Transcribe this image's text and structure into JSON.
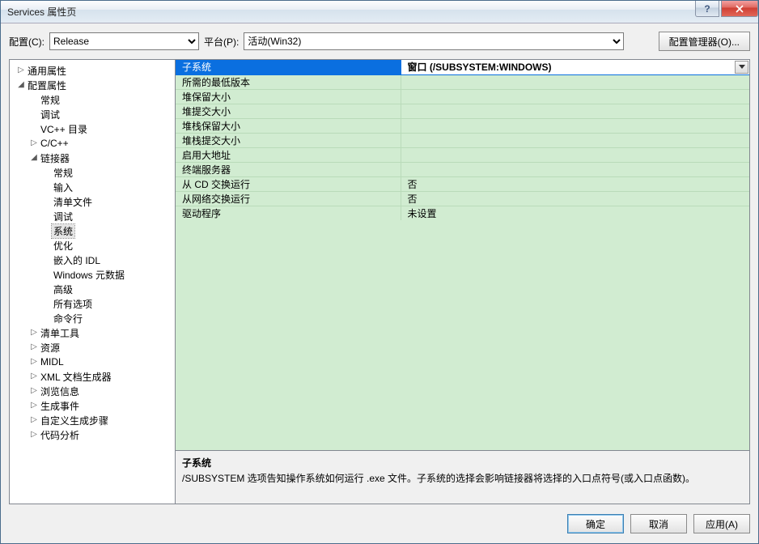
{
  "window": {
    "title": "Services 属性页"
  },
  "toolbar": {
    "config_label": "配置(C):",
    "config_value": "Release",
    "platform_label": "平台(P):",
    "platform_value": "活动(Win32)",
    "config_manager_label": "配置管理器(O)..."
  },
  "tree": [
    {
      "depth": 0,
      "exp": "▷",
      "label": "通用属性"
    },
    {
      "depth": 0,
      "exp": "◢",
      "label": "配置属性"
    },
    {
      "depth": 1,
      "exp": "",
      "label": "常规"
    },
    {
      "depth": 1,
      "exp": "",
      "label": "调试"
    },
    {
      "depth": 1,
      "exp": "",
      "label": "VC++ 目录"
    },
    {
      "depth": 1,
      "exp": "▷",
      "label": "C/C++"
    },
    {
      "depth": 1,
      "exp": "◢",
      "label": "链接器"
    },
    {
      "depth": 2,
      "exp": "",
      "label": "常规"
    },
    {
      "depth": 2,
      "exp": "",
      "label": "输入"
    },
    {
      "depth": 2,
      "exp": "",
      "label": "清单文件"
    },
    {
      "depth": 2,
      "exp": "",
      "label": "调试"
    },
    {
      "depth": 2,
      "exp": "",
      "label": "系统",
      "selected": true
    },
    {
      "depth": 2,
      "exp": "",
      "label": "优化"
    },
    {
      "depth": 2,
      "exp": "",
      "label": "嵌入的 IDL"
    },
    {
      "depth": 2,
      "exp": "",
      "label": "Windows 元数据"
    },
    {
      "depth": 2,
      "exp": "",
      "label": "高级"
    },
    {
      "depth": 2,
      "exp": "",
      "label": "所有选项"
    },
    {
      "depth": 2,
      "exp": "",
      "label": "命令行"
    },
    {
      "depth": 1,
      "exp": "▷",
      "label": "清单工具"
    },
    {
      "depth": 1,
      "exp": "▷",
      "label": "资源"
    },
    {
      "depth": 1,
      "exp": "▷",
      "label": "MIDL"
    },
    {
      "depth": 1,
      "exp": "▷",
      "label": "XML 文档生成器"
    },
    {
      "depth": 1,
      "exp": "▷",
      "label": "浏览信息"
    },
    {
      "depth": 1,
      "exp": "▷",
      "label": "生成事件"
    },
    {
      "depth": 1,
      "exp": "▷",
      "label": "自定义生成步骤"
    },
    {
      "depth": 1,
      "exp": "▷",
      "label": "代码分析"
    }
  ],
  "props": [
    {
      "name": "子系统",
      "value": "窗口 (/SUBSYSTEM:WINDOWS)",
      "selected": true
    },
    {
      "name": "所需的最低版本",
      "value": ""
    },
    {
      "name": "堆保留大小",
      "value": ""
    },
    {
      "name": "堆提交大小",
      "value": ""
    },
    {
      "name": "堆栈保留大小",
      "value": ""
    },
    {
      "name": "堆栈提交大小",
      "value": ""
    },
    {
      "name": "启用大地址",
      "value": ""
    },
    {
      "name": "终端服务器",
      "value": ""
    },
    {
      "name": "从 CD 交换运行",
      "value": "否"
    },
    {
      "name": "从网络交换运行",
      "value": "否"
    },
    {
      "name": "驱动程序",
      "value": "未设置"
    }
  ],
  "description": {
    "title": "子系统",
    "text": "/SUBSYSTEM 选项告知操作系统如何运行 .exe 文件。子系统的选择会影响链接器将选择的入口点符号(或入口点函数)。"
  },
  "buttons": {
    "ok": "确定",
    "cancel": "取消",
    "apply": "应用(A)"
  },
  "winctrl": {
    "help": "?"
  }
}
